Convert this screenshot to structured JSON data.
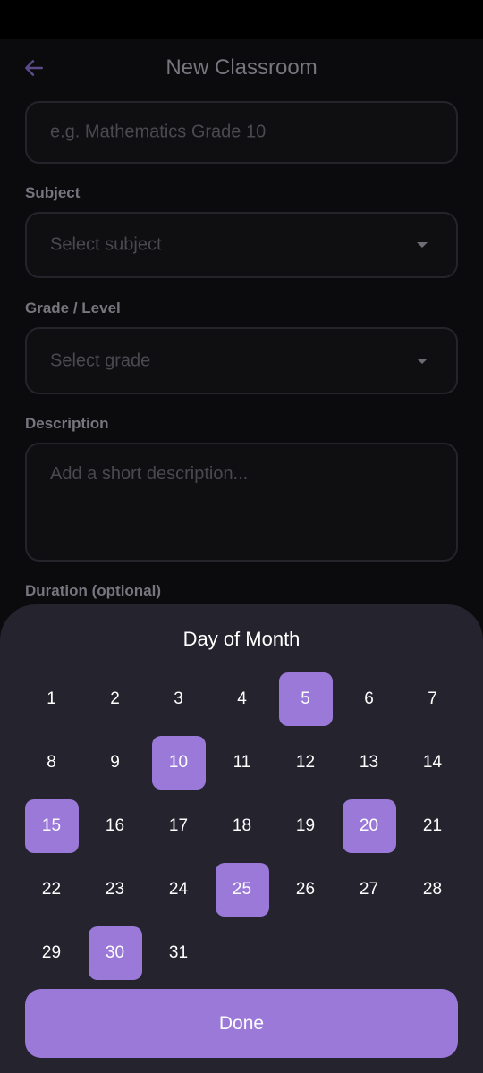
{
  "header": {
    "title": "New Classroom",
    "back_icon": "arrow-left-icon"
  },
  "form": {
    "name_placeholder": "e.g. Mathematics Grade 10",
    "subject_label": "Subject",
    "subject_placeholder": "Select subject",
    "grade_label": "Grade / Level",
    "grade_placeholder": "Select grade",
    "description_label": "Description",
    "description_placeholder": "Add a short description...",
    "duration_label": "Duration (optional)"
  },
  "picker": {
    "title": "Day of Month",
    "days": [
      "1",
      "2",
      "3",
      "4",
      "5",
      "6",
      "7",
      "8",
      "9",
      "10",
      "11",
      "12",
      "13",
      "14",
      "15",
      "16",
      "17",
      "18",
      "19",
      "20",
      "21",
      "22",
      "23",
      "24",
      "25",
      "26",
      "27",
      "28",
      "29",
      "30",
      "31"
    ],
    "selected": [
      "5",
      "10",
      "15",
      "20",
      "25",
      "30"
    ],
    "done_label": "Done"
  },
  "colors": {
    "accent": "#9b79d9",
    "sheet_bg": "#24232e",
    "page_bg": "#0b0b0e"
  }
}
